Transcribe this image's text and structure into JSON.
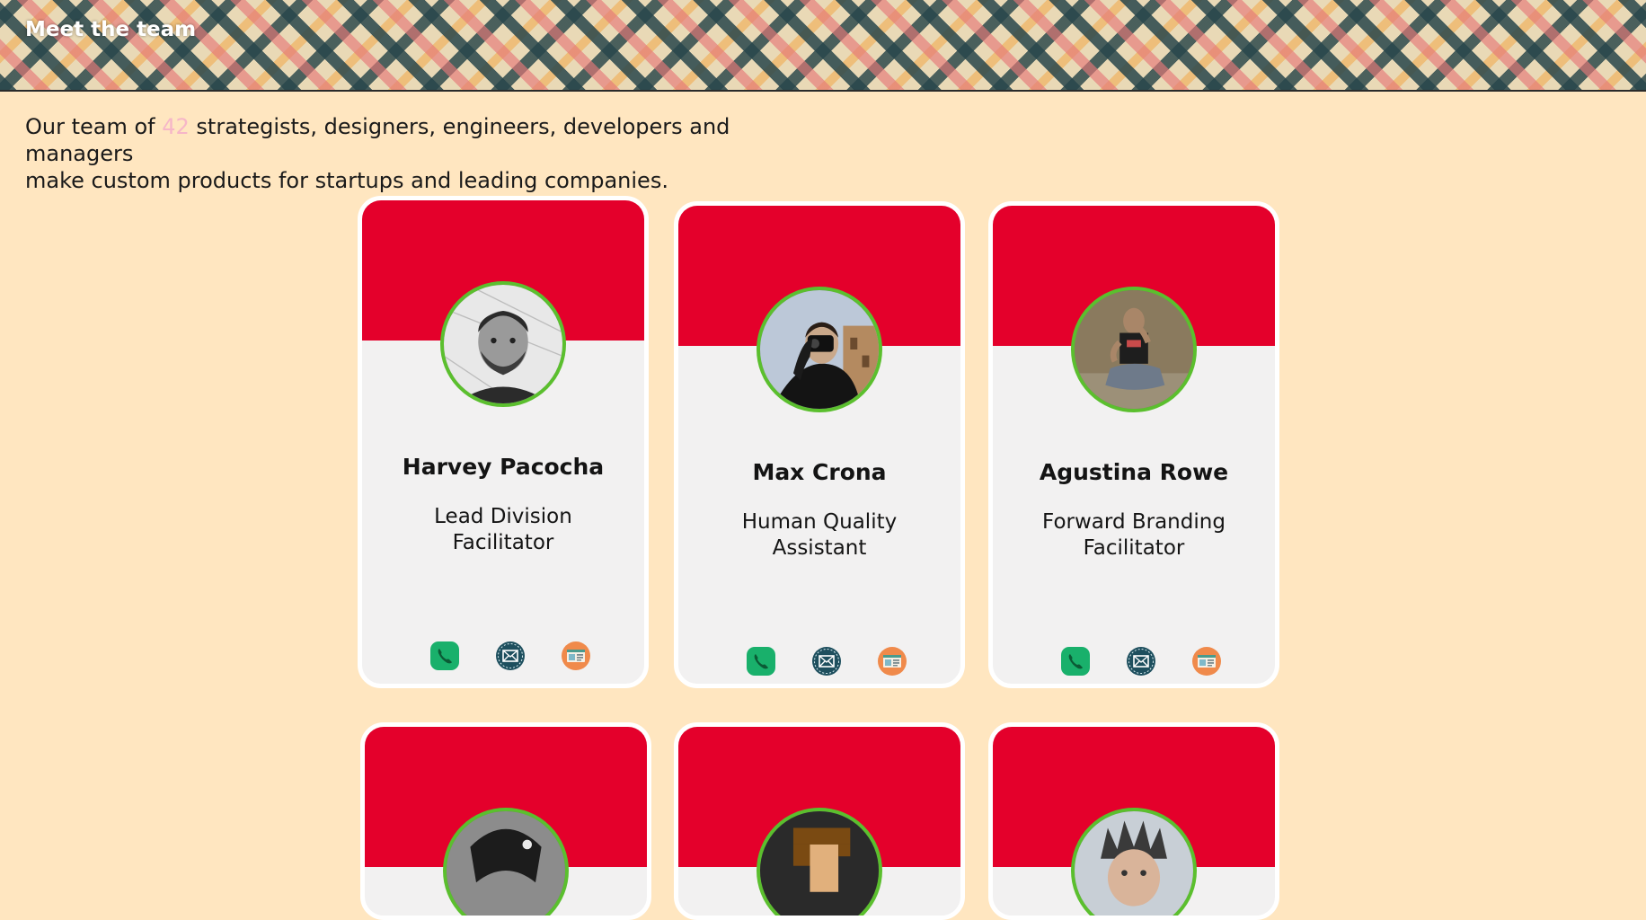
{
  "header": {
    "title": "Meet the team"
  },
  "intro": {
    "before": "Our team of ",
    "count": "42",
    "after_line1": " strategists, designers, engineers, developers and managers",
    "line2": "make custom products for startups and leading companies."
  },
  "colors": {
    "background": "#ffe6c0",
    "card_banner": "#e4002b",
    "card_body": "#f2f1f1",
    "avatar_ring": "#5bbf2e",
    "count_highlight": "#f6b6c8",
    "phone_icon": "#19b06b",
    "mail_icon": "#1e4f5e",
    "web_icon": "#f08a4b"
  },
  "members": [
    {
      "name": "Harvey Pacocha",
      "title": "Lead Division Facilitator",
      "avatar": "man-beard-avatar"
    },
    {
      "name": "Max Crona",
      "title": "Human Quality Assistant",
      "avatar": "photographer-avatar"
    },
    {
      "name": "Agustina Rowe",
      "title": "Forward Branding Facilitator",
      "avatar": "seated-man-avatar"
    },
    {
      "name": "",
      "title": "",
      "avatar": "grayscale-avatar"
    },
    {
      "name": "",
      "title": "",
      "avatar": "pixel-art-avatar"
    },
    {
      "name": "",
      "title": "",
      "avatar": "spiky-hair-avatar"
    }
  ],
  "contact_icons": [
    "phone-icon",
    "mail-icon",
    "website-icon"
  ]
}
